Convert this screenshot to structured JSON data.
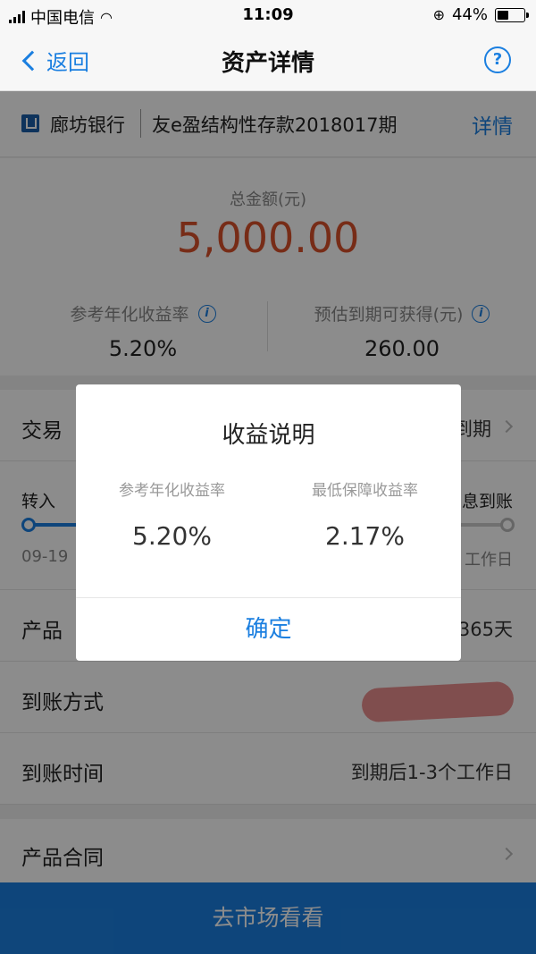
{
  "status_bar": {
    "carrier": "中国电信",
    "time": "11:09",
    "battery": "44%",
    "battery_level": 0.44
  },
  "nav": {
    "back_label": "返回",
    "title": "资产详情",
    "help_icon": "?"
  },
  "bank": {
    "name": "廊坊银行",
    "product": "友e盈结构性存款2018017期",
    "detail_link": "详情"
  },
  "summary": {
    "total_label": "总金额(元)",
    "total_value": "5,000.00",
    "rate_label": "参考年化收益率",
    "rate_value": "5.20%",
    "expected_label": "预估到期可获得(元)",
    "expected_value": "260.00"
  },
  "rows": {
    "trade_label": "交易",
    "trade_value": "到期",
    "progress_start_label": "转入",
    "progress_end_label": "息到账",
    "progress_start_date": "09-19",
    "progress_end_date": "工作日",
    "term_label": "产品",
    "term_value": "365天",
    "arrival_method_label": "到账方式",
    "arrival_method_value": ")",
    "arrival_time_label": "到账时间",
    "arrival_time_value": "到期后1-3个工作日",
    "contract_label": "产品合同"
  },
  "bottom_button": "去市场看看",
  "modal": {
    "title": "收益说明",
    "left_label": "参考年化收益率",
    "left_value": "5.20%",
    "right_label": "最低保障收益率",
    "right_value": "2.17%",
    "confirm": "确定"
  },
  "colors": {
    "accent": "#1b7fe0",
    "amount": "#d9502a",
    "redaction": "#ea8f8f"
  }
}
